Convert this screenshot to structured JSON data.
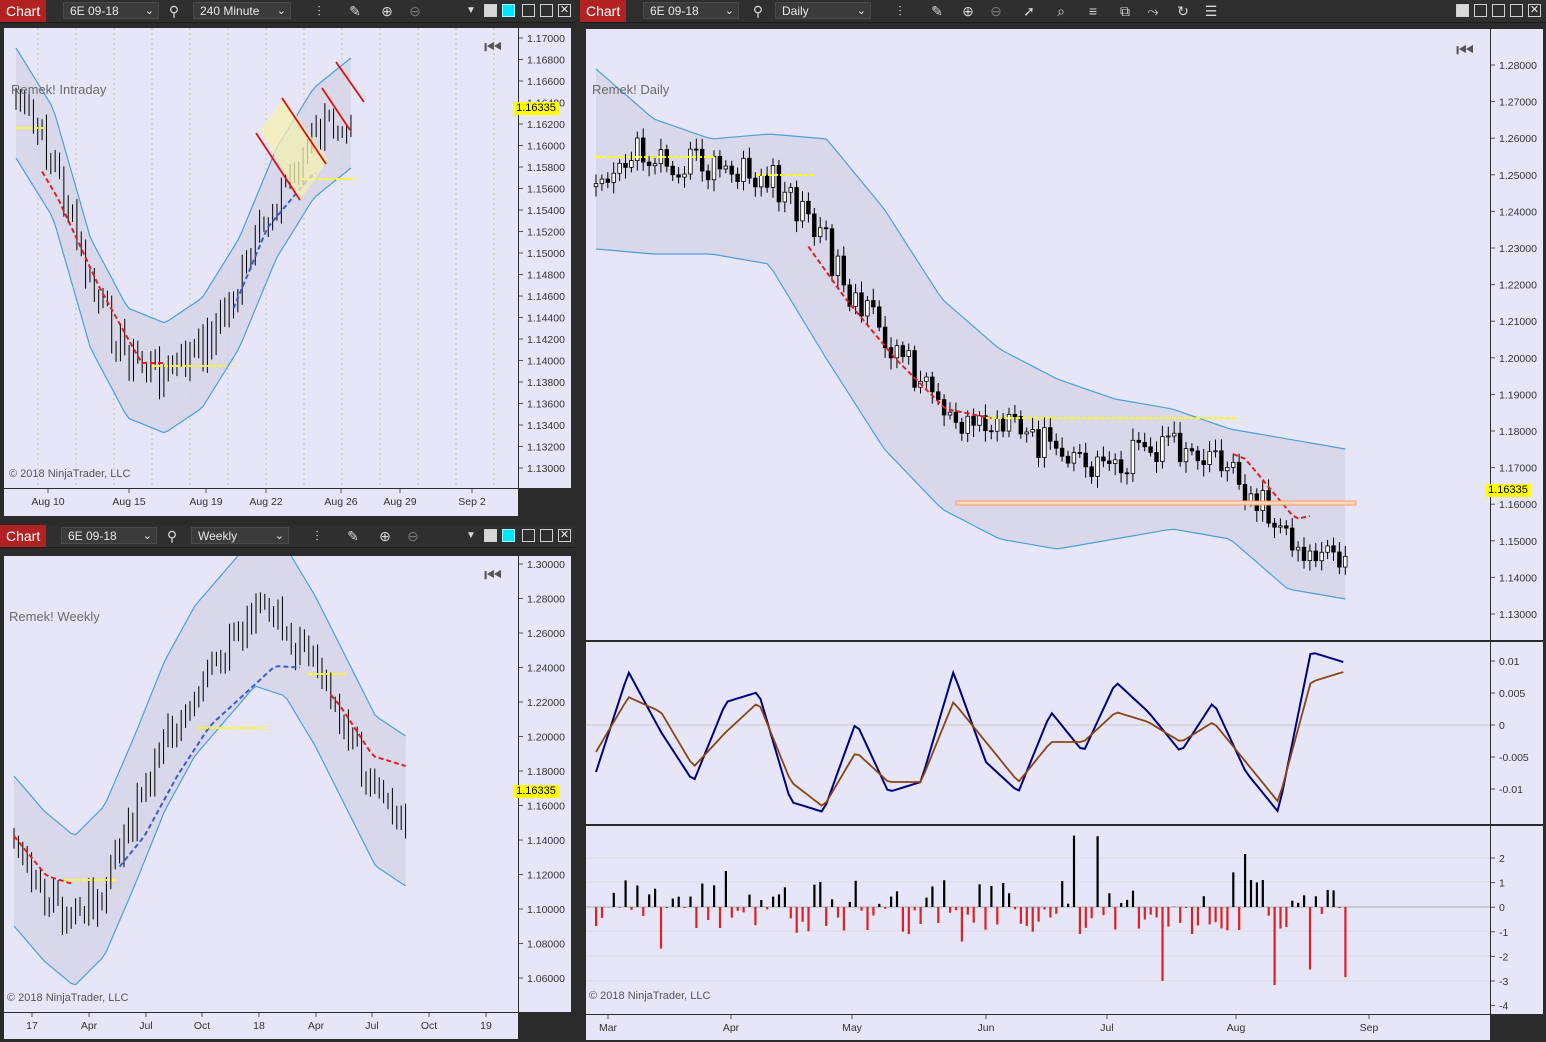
{
  "colors": {
    "accent": "#b22222",
    "price_tag": "#ffff00",
    "bull": "#ffffff",
    "bear": "#000000",
    "band": "#4a9fe0",
    "ma_down": "#e02020",
    "ma_up": "#3b5bd6",
    "osc_fast": "#000080",
    "osc_slow": "#8b4513",
    "hist_pos": "#000000",
    "hist_neg": "#e02020",
    "support": "#ff9966",
    "plot_bg": "#e6e6f8"
  },
  "windows": {
    "intraday": {
      "chart_label": "Chart",
      "instrument": "6E 09-18",
      "interval": "240 Minute",
      "name": "Remek! Intraday",
      "copyright": "© 2018 NinjaTrader, LLC",
      "last_price": "1.16335",
      "y_ticks": [
        "1.17000",
        "1.16800",
        "1.16600",
        "1.16400",
        "1.16200",
        "1.16000",
        "1.15800",
        "1.15600",
        "1.15400",
        "1.15200",
        "1.15000",
        "1.14800",
        "1.14600",
        "1.14400",
        "1.14200",
        "1.14000",
        "1.13800",
        "1.13600",
        "1.13400",
        "1.13200",
        "1.13000"
      ],
      "x_ticks": [
        "Aug 10",
        "Aug 15",
        "Aug 19",
        "Aug 22",
        "Aug 26",
        "Aug 29",
        "Sep 2"
      ]
    },
    "weekly": {
      "chart_label": "Chart",
      "instrument": "6E 09-18",
      "interval": "Weekly",
      "name": "Remek! Weekly",
      "copyright": "© 2018 NinjaTrader, LLC",
      "last_price": "1.16335",
      "y_ticks": [
        "1.30000",
        "1.28000",
        "1.26000",
        "1.24000",
        "1.22000",
        "1.20000",
        "1.18000",
        "1.16000",
        "1.14000",
        "1.12000",
        "1.10000",
        "1.08000",
        "1.06000"
      ],
      "x_ticks": [
        "17",
        "Apr",
        "Jul",
        "Oct",
        "18",
        "Apr",
        "Jul",
        "Oct",
        "19"
      ]
    },
    "daily": {
      "chart_label": "Chart",
      "instrument": "6E 09-18",
      "interval": "Daily",
      "name": "Remek! Daily",
      "copyright": "© 2018 NinjaTrader, LLC",
      "last_price": "1.16335",
      "y_ticks": [
        "1.28000",
        "1.27000",
        "1.26000",
        "1.25000",
        "1.24000",
        "1.23000",
        "1.22000",
        "1.21000",
        "1.20000",
        "1.19000",
        "1.18000",
        "1.17000",
        "1.16000",
        "1.15000",
        "1.14000",
        "1.13000"
      ],
      "osc_ticks": [
        "0.01",
        "0.005",
        "0",
        "-0.005",
        "-0.01"
      ],
      "hist_ticks": [
        "2",
        "1",
        "0",
        "-1",
        "-2",
        "-3",
        "-4"
      ],
      "x_ticks": [
        "Mar",
        "Apr",
        "May",
        "Jun",
        "Jul",
        "Aug",
        "Sep"
      ]
    }
  }
}
